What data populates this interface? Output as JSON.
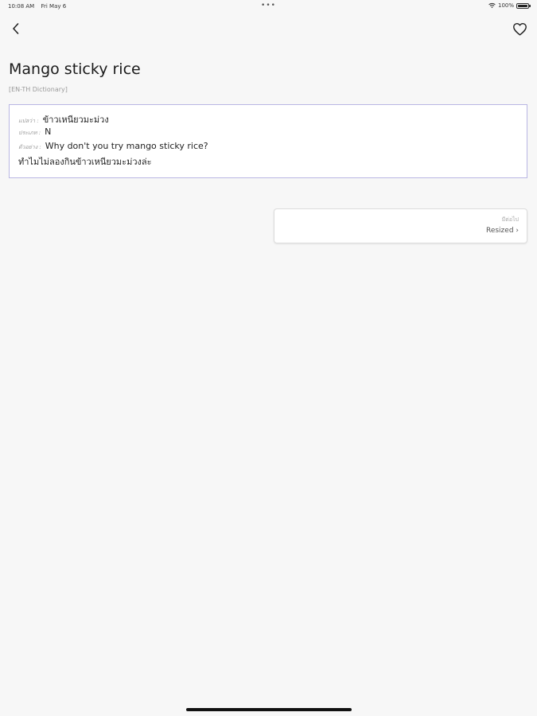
{
  "status_bar": {
    "time": "10:08 AM",
    "date": "Fri May 6",
    "center_dots": "•••",
    "battery_percent": "100%",
    "icons": [
      "wifi-icon",
      "battery-icon"
    ]
  },
  "nav": {
    "back_icon": "chevron-left-icon",
    "favorite_icon": "heart-outline-icon"
  },
  "entry": {
    "word": "Mango sticky rice",
    "source": "[EN-TH Dictionary]"
  },
  "definition": {
    "translation_label": "แปลว่า :",
    "translation": "ข้าวเหนียวมะม่วง",
    "pos_label": "ประเภท :",
    "pos": "N",
    "example_label": "ตัวอย่าง :",
    "example_en": "Why don't you try mango sticky rice?",
    "example_th": "ทำไมไม่ลองกินข้าวเหนียวมะม่วงล่ะ"
  },
  "info_card": {
    "meaning_label": "มีต่อไป",
    "link_label": "Resized ›"
  },
  "colors": {
    "background": "#f7f7f7",
    "card_border_accent": "#b9b6e3"
  }
}
